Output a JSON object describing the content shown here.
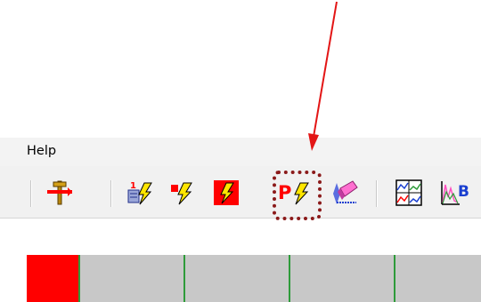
{
  "menubar": {
    "help_label": "Help"
  },
  "toolbar": {
    "buttons": [
      {
        "icon": "pipeline-icon"
      },
      {
        "icon": "numbered-lightning-icon"
      },
      {
        "icon": "red-flag-lightning-icon"
      },
      {
        "icon": "red-square-lightning-icon"
      },
      {
        "icon": "p-lightning-icon",
        "letter": "P"
      },
      {
        "icon": "eraser-icon"
      },
      {
        "icon": "grid-chart-icon"
      },
      {
        "icon": "spectrum-chart-icon",
        "letter": "B"
      }
    ]
  },
  "colors": {
    "annotation_arrow": "#e31515",
    "highlight_box": "#8b1a1a",
    "timeline_marker": "#ff0000",
    "timeline_ticks": "#2e9b3a"
  }
}
